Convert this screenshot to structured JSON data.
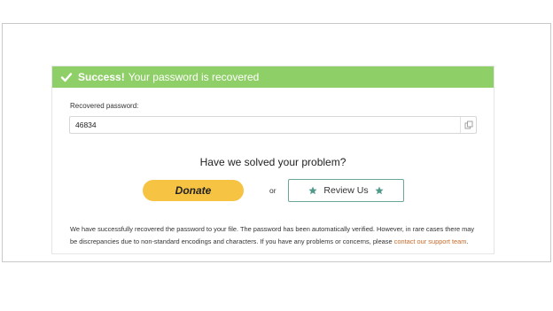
{
  "banner": {
    "success_label": "Success!",
    "message": "Your password is recovered",
    "background": "#8fcf67",
    "icon": "check-icon"
  },
  "recovered": {
    "label": "Recovered password:",
    "value": "46834",
    "copy_icon": "copy-icon"
  },
  "prompt": {
    "question": "Have we solved your problem?"
  },
  "actions": {
    "donate_label": "Donate",
    "donate_color": "#f6c343",
    "or_label": "or",
    "review_label": "Review Us",
    "review_icon": "star-icon",
    "review_border": "#6aa79a"
  },
  "note": {
    "text": "We have successfully recovered the password to your file. The password has been automatically verified. However, in rare cases there may be discrepancies due to non-standard encodings and characters. If you have any problems or concerns, please ",
    "link_text": "contact our support team",
    "link_color": "#c66a2b",
    "end": "."
  }
}
